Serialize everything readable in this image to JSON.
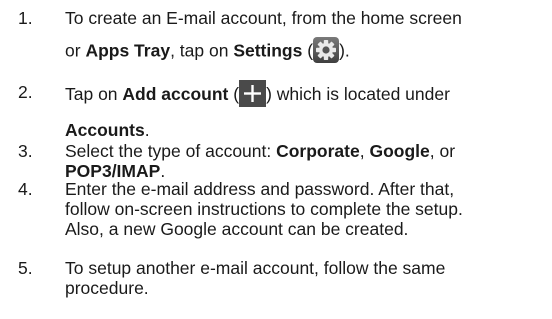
{
  "steps": [
    {
      "number": "1.",
      "line1_a": "To create an E-mail account, from the home screen",
      "line2_a": "or ",
      "line2_b": "Apps Tray",
      "line2_c": ", tap on ",
      "line2_d": "Settings",
      "line2_e": " (",
      "line2_f": ").",
      "icon": "settings-gear-icon"
    },
    {
      "number": "2.",
      "line1_a": "Tap on ",
      "line1_b": "Add account",
      "line1_c": " (",
      "line1_d": ") which is located under",
      "line2_a": "Accounts",
      "line2_b": ".",
      "icon": "plus-icon"
    },
    {
      "number": "3.",
      "line1_a": "Select the type of account: ",
      "line1_b": "Corporate",
      "line1_c": ", ",
      "line1_d": "Google",
      "line1_e": ", or",
      "line2_a": "POP3/IMAP",
      "line2_b": "."
    },
    {
      "number": "4.",
      "line1": "Enter the e-mail address and password. After that,",
      "line2": "follow on-screen instructions to complete the setup.",
      "line3": "Also, a new Google account can be created."
    },
    {
      "number": "5.",
      "line1": "To setup another e-mail account, follow the same",
      "line2": "procedure."
    }
  ]
}
